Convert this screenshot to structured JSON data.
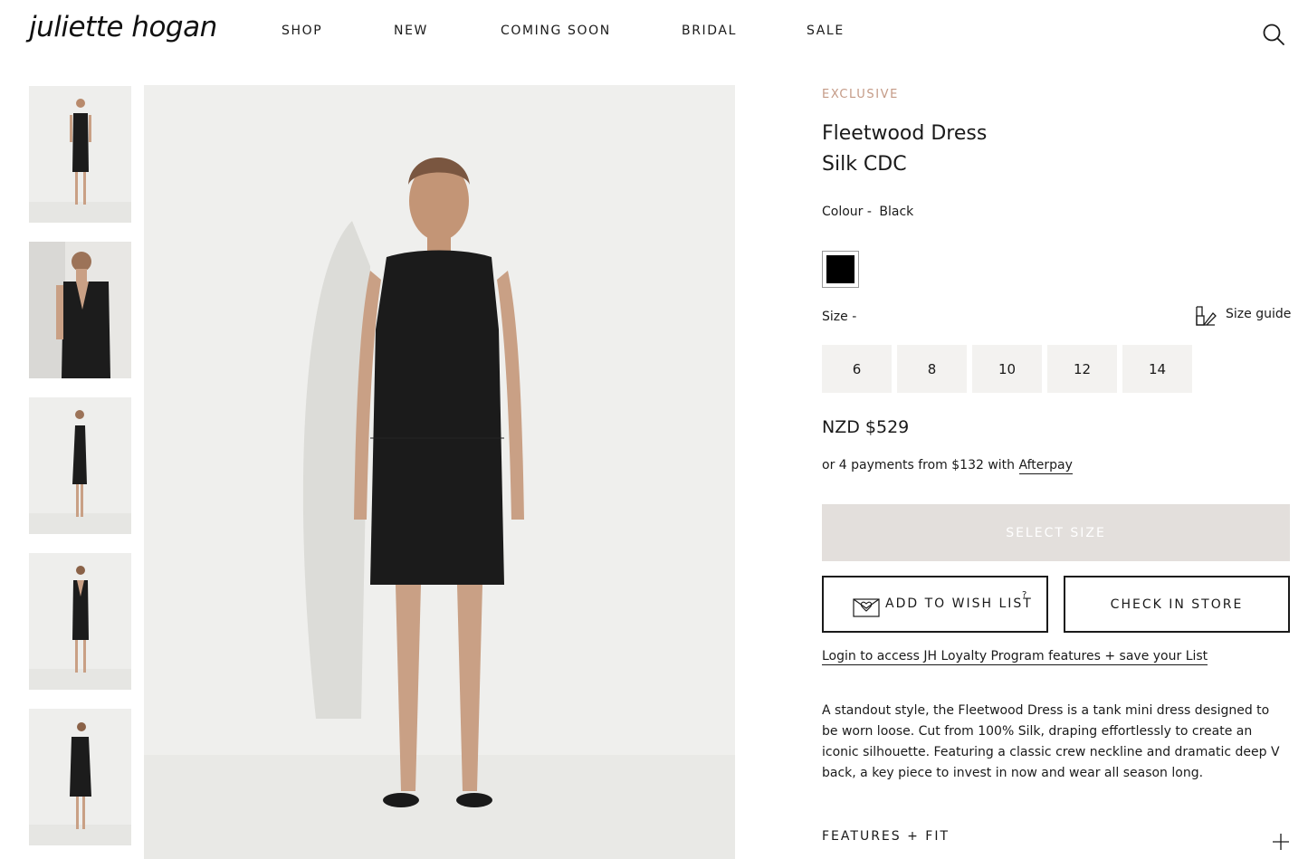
{
  "header": {
    "logo": "juliette hogan",
    "nav": [
      {
        "label": "SHOP"
      },
      {
        "label": "NEW"
      },
      {
        "label": "COMING SOON"
      },
      {
        "label": "BRIDAL"
      },
      {
        "label": "SALE"
      }
    ],
    "search_icon": "search-icon"
  },
  "gallery": {
    "thumbnails": [
      "front-view",
      "back-view",
      "side-view",
      "back-full-view",
      "side-back-view"
    ],
    "main_image": "front-view-full"
  },
  "product": {
    "eyebrow": "EXCLUSIVE",
    "title_line1": "Fleetwood Dress",
    "title_line2": "Silk CDC",
    "colour_label": "Colour -",
    "colour_value": "Black",
    "swatch_color": "#000000",
    "size_label": "Size -",
    "size_guide_label": "Size guide",
    "sizes": [
      "6",
      "8",
      "10",
      "12",
      "14"
    ],
    "price": "NZD $529",
    "afterpay_text": "or 4 payments from $132 with",
    "afterpay_link": "Afterpay",
    "select_size_label": "SELECT SIZE",
    "wish_list_label": "ADD TO WISH LIST",
    "wish_list_help": "?",
    "check_store_label": "CHECK IN STORE",
    "login_link": "Login to access JH Loyalty Program features + save your List",
    "description": "A standout style, the Fleetwood Dress is a tank mini dress designed to be worn loose. Cut from 100% Silk, draping effortlessly to create an iconic silhouette. Featuring a classic crew neckline and dramatic deep V back, a key piece to invest in now and wear all season long.",
    "features_label": "FEATURES + FIT"
  },
  "colors": {
    "accent": "#c49a86",
    "button_disabled": "#e3dfdc",
    "size_bg": "#f3f2f0"
  }
}
